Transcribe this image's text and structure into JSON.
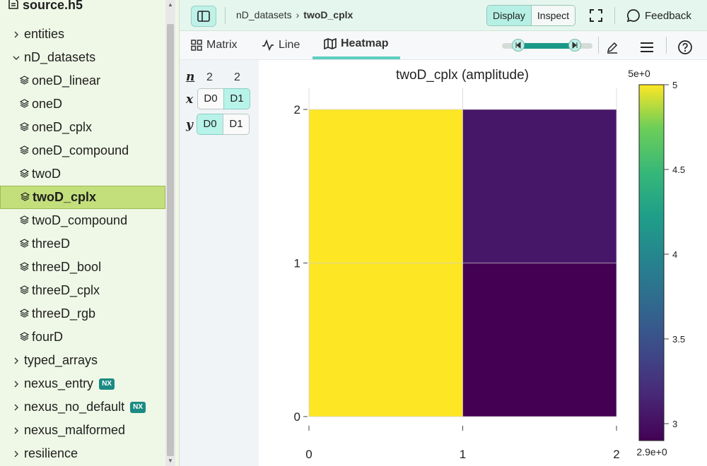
{
  "file": {
    "name": "source.h5",
    "icon": "file-icon"
  },
  "tree": {
    "items": [
      {
        "label": "entities",
        "kind": "group",
        "expanded": false
      },
      {
        "label": "nD_datasets",
        "kind": "group",
        "expanded": true
      },
      {
        "label": "oneD_linear",
        "kind": "dataset"
      },
      {
        "label": "oneD",
        "kind": "dataset"
      },
      {
        "label": "oneD_cplx",
        "kind": "dataset"
      },
      {
        "label": "oneD_compound",
        "kind": "dataset"
      },
      {
        "label": "twoD",
        "kind": "dataset"
      },
      {
        "label": "twoD_cplx",
        "kind": "dataset",
        "selected": true
      },
      {
        "label": "twoD_compound",
        "kind": "dataset"
      },
      {
        "label": "threeD",
        "kind": "dataset"
      },
      {
        "label": "threeD_bool",
        "kind": "dataset"
      },
      {
        "label": "threeD_cplx",
        "kind": "dataset"
      },
      {
        "label": "threeD_rgb",
        "kind": "dataset"
      },
      {
        "label": "fourD",
        "kind": "dataset"
      },
      {
        "label": "typed_arrays",
        "kind": "group",
        "expanded": false
      },
      {
        "label": "nexus_entry",
        "kind": "group",
        "expanded": false,
        "badge": "NX"
      },
      {
        "label": "nexus_no_default",
        "kind": "group",
        "expanded": false,
        "badge": "NX"
      },
      {
        "label": "nexus_malformed",
        "kind": "group",
        "expanded": false
      },
      {
        "label": "resilience",
        "kind": "group",
        "expanded": false
      }
    ]
  },
  "topbar": {
    "breadcrumb": {
      "parent": "nD_datasets",
      "separator": "›",
      "current": "twoD_cplx"
    },
    "modes": {
      "display": "Display",
      "inspect": "Inspect",
      "active": "display"
    },
    "feedback": "Feedback"
  },
  "toolbar": {
    "tabs": [
      {
        "label": "Matrix",
        "icon": "grid-icon",
        "active": false
      },
      {
        "label": "Line",
        "icon": "line-chart-icon",
        "active": false
      },
      {
        "label": "Heatmap",
        "icon": "map-icon",
        "active": true
      }
    ],
    "icons": [
      "pencil-icon",
      "menu-icon",
      "help-icon"
    ]
  },
  "dims": {
    "n_label": "n",
    "x_label": "x",
    "y_label": "y",
    "sizes": [
      "2",
      "2"
    ],
    "buttons": [
      "D0",
      "D1"
    ],
    "x_selected": "D1",
    "y_selected": "D0"
  },
  "chart_data": {
    "type": "heatmap",
    "title": "twoD_cplx (amplitude)",
    "x_ticks": [
      "0",
      "1",
      "2"
    ],
    "y_ticks": [
      "0",
      "1",
      "2"
    ],
    "xlim": [
      0,
      2
    ],
    "ylim": [
      0,
      2
    ],
    "values": [
      [
        5.0,
        2.9
      ],
      [
        5.0,
        3.05
      ]
    ],
    "colormap": "viridis",
    "color_range": [
      2.9,
      5.0
    ],
    "colorbar": {
      "max_label": "5e+0",
      "min_label": "2.9e+0",
      "ticks": [
        "5",
        "4.5",
        "4",
        "3.5",
        "3"
      ]
    },
    "grid": true
  },
  "colors": {
    "sidebar_bg": "#eff8e6",
    "selected_bg": "#c3df7c",
    "accent": "#5dcfbf",
    "nx_badge": "#1b8a84"
  }
}
